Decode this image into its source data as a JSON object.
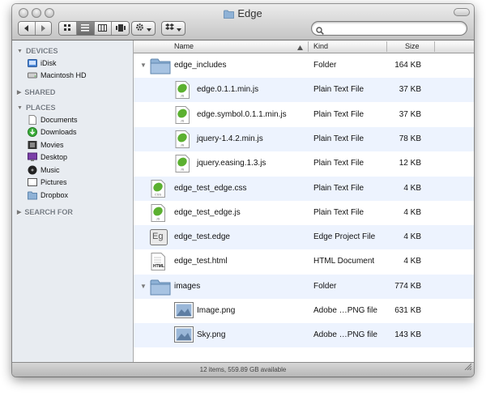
{
  "window": {
    "title": "Edge"
  },
  "toolbar": {
    "back_icon": "back-arrow-icon",
    "forward_icon": "forward-arrow-icon",
    "view_modes": [
      "icon-view",
      "list-view",
      "column-view",
      "cover-flow-view"
    ],
    "active_view": "list-view",
    "action_icon": "gear-icon",
    "share_icon": "dropbox-icon",
    "search": {
      "value": "",
      "placeholder": ""
    }
  },
  "sidebar": {
    "devices": {
      "label": "DEVICES",
      "items": [
        {
          "label": "iDisk",
          "icon": "idisk-icon"
        },
        {
          "label": "Macintosh HD",
          "icon": "hard-drive-icon"
        }
      ]
    },
    "shared": {
      "label": "SHARED"
    },
    "places": {
      "label": "PLACES",
      "items": [
        {
          "label": "Documents",
          "icon": "documents-icon"
        },
        {
          "label": "Downloads",
          "icon": "downloads-icon"
        },
        {
          "label": "Movies",
          "icon": "movies-icon"
        },
        {
          "label": "Desktop",
          "icon": "desktop-icon"
        },
        {
          "label": "Music",
          "icon": "music-icon"
        },
        {
          "label": "Pictures",
          "icon": "pictures-icon"
        },
        {
          "label": "Dropbox",
          "icon": "dropbox-icon"
        }
      ]
    },
    "search_for": {
      "label": "SEARCH FOR"
    }
  },
  "columns": {
    "name": "Name",
    "kind": "Kind",
    "size": "Size"
  },
  "files": [
    {
      "name": "edge_includes",
      "kind": "Folder",
      "size": "164 KB",
      "icon": "folder-icon",
      "expanded": true
    },
    {
      "name": "edge.0.1.1.min.js",
      "kind": "Plain Text File",
      "size": "37 KB",
      "icon": "js-file-icon"
    },
    {
      "name": "edge.symbol.0.1.1.min.js",
      "kind": "Plain Text File",
      "size": "37 KB",
      "icon": "js-file-icon"
    },
    {
      "name": "jquery-1.4.2.min.js",
      "kind": "Plain Text File",
      "size": "78 KB",
      "icon": "js-file-icon"
    },
    {
      "name": "jquery.easing.1.3.js",
      "kind": "Plain Text File",
      "size": "12 KB",
      "icon": "js-file-icon"
    },
    {
      "name": "edge_test_edge.css",
      "kind": "Plain Text File",
      "size": "4 KB",
      "icon": "css-file-icon"
    },
    {
      "name": "edge_test_edge.js",
      "kind": "Plain Text File",
      "size": "4 KB",
      "icon": "js-file-icon"
    },
    {
      "name": "edge_test.edge",
      "kind": "Edge Project File",
      "size": "4 KB",
      "icon": "edge-project-icon",
      "badge": "Eg"
    },
    {
      "name": "edge_test.html",
      "kind": "HTML Document",
      "size": "4 KB",
      "icon": "html-file-icon",
      "badge": "HTML"
    },
    {
      "name": "images",
      "kind": "Folder",
      "size": "774 KB",
      "icon": "folder-icon",
      "expanded": true
    },
    {
      "name": "Image.png",
      "kind": "Adobe …PNG file",
      "size": "631 KB",
      "icon": "png-image-icon"
    },
    {
      "name": "Sky.png",
      "kind": "Adobe …PNG file",
      "size": "143 KB",
      "icon": "png-image-icon"
    }
  ],
  "status": {
    "text": "12 items, 559.89 GB available"
  },
  "colors": {
    "row_alt": "#edf3fe",
    "sidebar_bg": "#e8ecf1",
    "folder": "#8fb2d6"
  }
}
